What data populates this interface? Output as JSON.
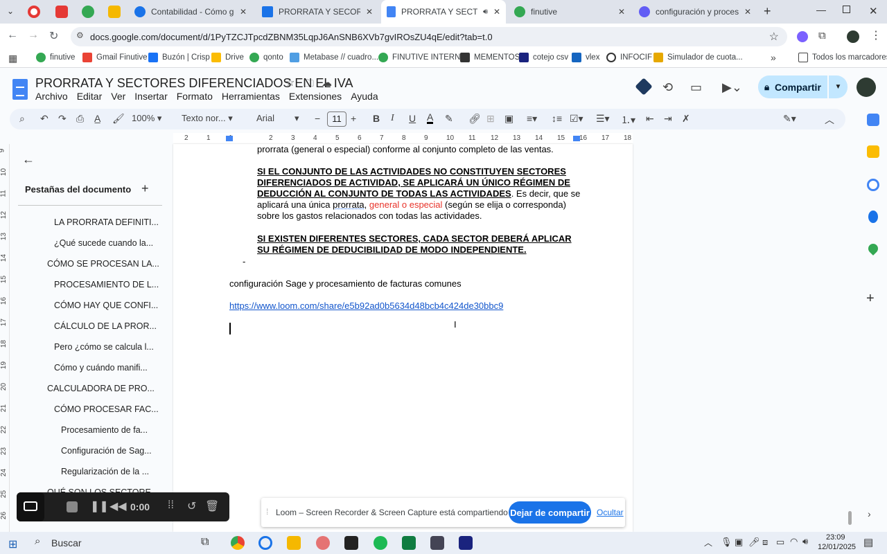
{
  "browser": {
    "tabs": [
      {
        "title": "Contabilidad - Cómo gestio",
        "favicon_color": "#1a73e8"
      },
      {
        "title": "PRORRATA Y SECORES DIFE",
        "favicon_color": "#fbbc04"
      },
      {
        "title": "PRORRATA Y SECTORES",
        "favicon_color": "#4285f4",
        "active": true
      },
      {
        "title": "finutive",
        "favicon_color": "#34a853"
      },
      {
        "title": "configuración y procesam",
        "favicon_color": "#625df5"
      }
    ],
    "url": "docs.google.com/document/d/1PyTZCJTpcdZBNM35LqpJ6AnSNB6XVb7gvIROsZU4qE/edit?tab=t.0",
    "bookmarks": [
      "finutive",
      "Gmail Finutive",
      "Buzón | Crisp",
      "Drive",
      "qonto",
      "Metabase // cuadro...",
      "FINUTIVE INTERNO",
      "MEMENTOS",
      "cotejo csv",
      "vlex",
      "INFOCIF",
      "Simulador de cuota..."
    ],
    "all_bookmarks": "Todos los marcadores"
  },
  "docs": {
    "title": "PRORRATA Y SECTORES DIFERENCIADOS EN EL IVA",
    "menus": [
      "Archivo",
      "Editar",
      "Ver",
      "Insertar",
      "Formato",
      "Herramientas",
      "Extensiones",
      "Ayuda"
    ],
    "share_label": "Compartir",
    "toolbar": {
      "zoom": "100%",
      "style": "Texto nor...",
      "font": "Arial",
      "font_size": "11"
    },
    "ruler_marks": [
      "2",
      "1",
      "1",
      "2",
      "3",
      "4",
      "5",
      "6",
      "7",
      "8",
      "9",
      "10",
      "11",
      "12",
      "13",
      "14",
      "15",
      "16",
      "17",
      "18"
    ],
    "vruler_marks": [
      "9",
      "10",
      "11",
      "12",
      "13",
      "14",
      "15",
      "16",
      "17",
      "18",
      "19",
      "20",
      "21",
      "22",
      "23",
      "24",
      "25",
      "26"
    ]
  },
  "tabs_panel": {
    "heading": "Pestañas del documento",
    "items": [
      "LA PRORRATA DEFINITI...",
      "¿Qué sucede cuando la...",
      "CÓMO SE PROCESAN LA...",
      "PROCESAMIENTO DE L...",
      "CÓMO HAY QUE CONFI...",
      "CÁLCULO DE LA PROR...",
      "Pero ¿cómo se calcula l...",
      "Cómo y cuándo manifi...",
      "CALCULADORA DE PRO...",
      "CÓMO PROCESAR FAC...",
      "Procesamiento de fa...",
      "Configuración de Sag...",
      "Regularización de la ...",
      "QUÉ SON LOS SECTORE..."
    ]
  },
  "document": {
    "line1": "prorrata (general o especial) conforme al conjunto completo de las ventas.",
    "p2_bold": "SI EL CONJUNTO DE LAS ACTIVIDADES NO CONSTITUYEN SECTORES DIFERENCIADOS DE ACTIVIDAD, SE APLICARÁ UN ÚNICO RÉGIMEN DE DEDUCCIÓN AL CONJUNTO DE TODAS LAS ACTIVIDADES",
    "p2_a": ". Es decir, que se aplicará una única ",
    "p2_prorrata": "prorrata",
    "p2_b": ", ",
    "p2_red": "general o especial",
    "p2_c": " (según se elija o corresponda) sobre los gastos relacionados con todas las actividades.",
    "p3_bold": "SI EXISTEN DIFERENTES SECTORES, CADA SECTOR DEBERÁ APLICAR SU RÉGIMEN DE DEDUCIBILIDAD DE MODO INDEPENDIENTE.",
    "dash": "-",
    "p4": "configuración Sage y procesamiento de facturas comunes",
    "link": "https://www.loom.com/share/e5b92ad0b5634d48bcb4c424de30bbc9"
  },
  "loom": {
    "timer": "0:00",
    "notice": "Loom – Screen Recorder & Screen Capture está compartiendo tu pantalla.",
    "stop_share": "Dejar de compartir",
    "hide": "Ocultar"
  },
  "taskbar": {
    "search": "Buscar",
    "time": "23:09",
    "date": "12/01/2025"
  }
}
